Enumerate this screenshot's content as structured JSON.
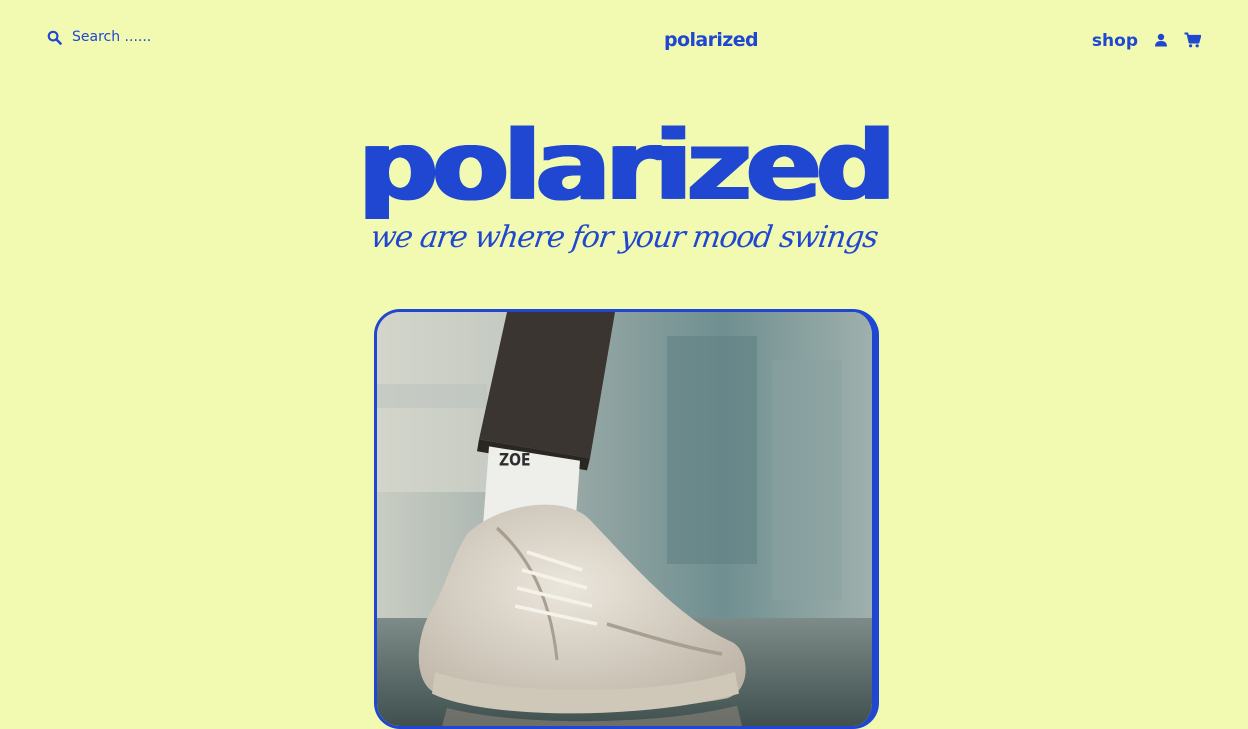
{
  "header": {
    "search": {
      "placeholder": "Search ......",
      "icon": "search-icon"
    },
    "brand": "polarized",
    "nav": {
      "shop_label": "shop",
      "account_icon": "user-icon",
      "cart_icon": "cart-icon"
    }
  },
  "hero": {
    "title": "polarized",
    "tagline": "we are where for your mood swings"
  },
  "photo": {
    "sock_text": "ZOE",
    "icon": "sneaker-photo"
  },
  "colors": {
    "background": "#f1fab0",
    "accent": "#1f47d1"
  }
}
